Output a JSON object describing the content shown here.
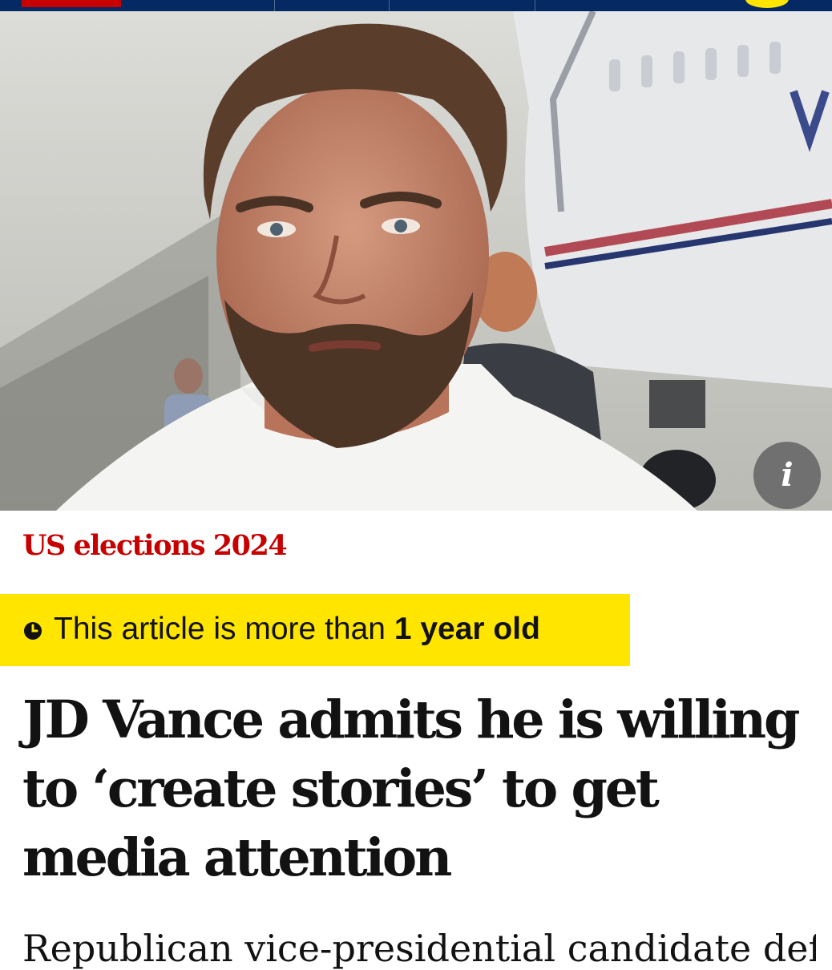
{
  "colors": {
    "nav_background": "#052962",
    "section_red": "#c70000",
    "warning_yellow": "#ffe500",
    "text": "#121212",
    "info_button": "#707070"
  },
  "hero": {
    "icons": [
      "info-icon"
    ],
    "info_glyph": "i"
  },
  "article": {
    "section": "US elections 2024",
    "age_warning": {
      "icon": "clock-icon",
      "prefix": "This article is more than ",
      "emphasis": "1 year old"
    },
    "headline": "JD Vance admits he is willing to ‘create stories’ to get media attention",
    "standfirst": "Republican vice-presidential candidate defends"
  }
}
